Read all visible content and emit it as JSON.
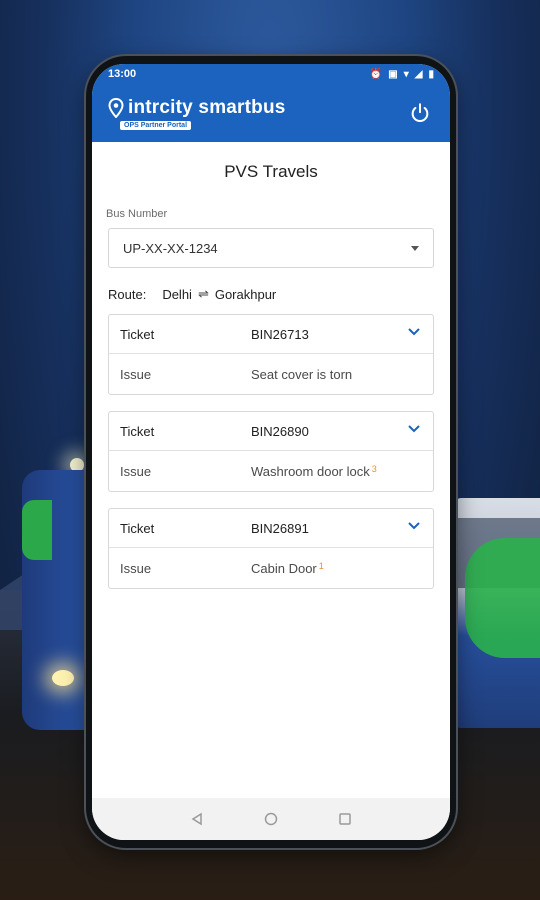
{
  "status_bar": {
    "time": "13:00"
  },
  "header": {
    "brand_name": "intrcity smartbus",
    "portal_label": "OPS Partner Portal",
    "power_icon": "power-icon"
  },
  "page": {
    "title": "PVS Travels",
    "bus_number_label": "Bus Number",
    "bus_number_value": "UP-XX-XX-1234",
    "route_label": "Route:",
    "route_from": "Delhi",
    "route_to": "Gorakhpur"
  },
  "tickets": [
    {
      "ticket_label": "Ticket",
      "ticket_id": "BIN26713",
      "issue_label": "Issue",
      "issue_text": "Seat cover is torn",
      "count": ""
    },
    {
      "ticket_label": "Ticket",
      "ticket_id": "BIN26890",
      "issue_label": "Issue",
      "issue_text": "Washroom door lock",
      "count": "3"
    },
    {
      "ticket_label": "Ticket",
      "ticket_id": "BIN26891",
      "issue_label": "Issue",
      "issue_text": "Cabin Door",
      "count": "1"
    }
  ],
  "colors": {
    "accent": "#1b63bf",
    "count_badge": "#e8902b"
  }
}
